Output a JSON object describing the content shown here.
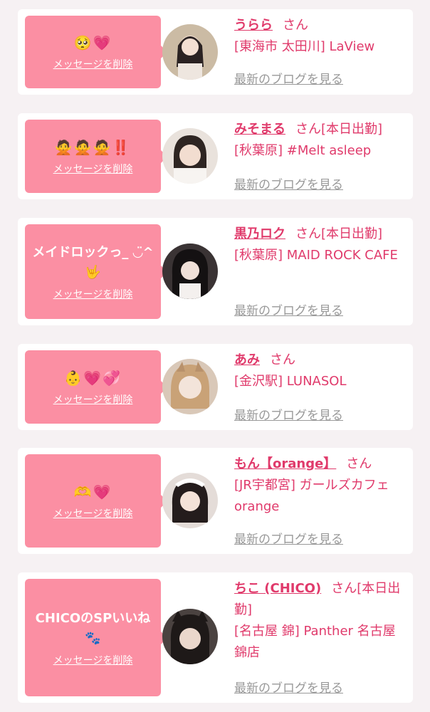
{
  "cards": [
    {
      "message": "🥺💗",
      "delete_label": "メッセージを削除",
      "name": "うらら",
      "honorific": "さん",
      "status": "",
      "location": "[東海市 太田川] LaView",
      "blog_label": "最新のブログを見る"
    },
    {
      "message": "🙅🙅🙅‼️",
      "delete_label": "メッセージを削除",
      "name": "みそまる",
      "honorific": "さん",
      "status": "[本日出勤]",
      "location": "[秋葉原] #Melt asleep",
      "blog_label": "最新のブログを見る"
    },
    {
      "message": "メイドロックっ_ ◡̈^🤟",
      "delete_label": "メッセージを削除",
      "name": "黒乃ロク",
      "honorific": "さん",
      "status": "[本日出勤]",
      "location": "[秋葉原] MAID ROCK CAFE",
      "blog_label": "最新のブログを見る"
    },
    {
      "message": "👶💗💞",
      "delete_label": "メッセージを削除",
      "name": "あみ",
      "honorific": "さん",
      "status": "",
      "location": "[金沢駅] LUNASOL",
      "blog_label": "最新のブログを見る"
    },
    {
      "message": "🫶💗",
      "delete_label": "メッセージを削除",
      "name": "もん【orange】",
      "honorific": "さん",
      "status": "",
      "location": "[JR宇都宮] ガールズカフェ orange",
      "blog_label": "最新のブログを見る"
    },
    {
      "message": "CHICOのSPいいね🐾",
      "delete_label": "メッセージを削除",
      "name": "ちこ (CHICO)",
      "honorific": "さん",
      "status": "[本日出勤]",
      "location": "[名古屋 錦] Panther 名古屋錦店",
      "blog_label": "最新のブログを見る"
    }
  ],
  "colors": {
    "accent": "#e03a6b",
    "bubble": "#fb8fa3",
    "page_bg": "#f6f1f3"
  }
}
